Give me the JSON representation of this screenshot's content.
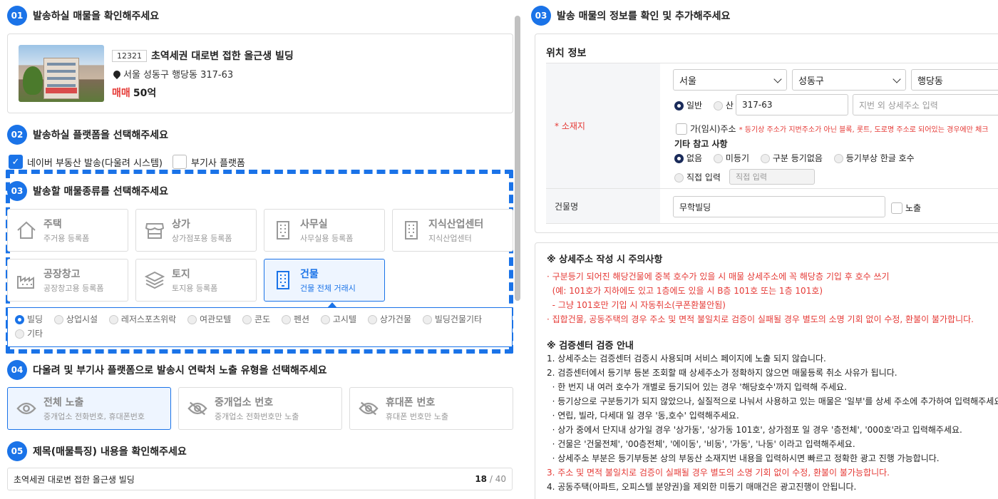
{
  "sec1": {
    "num": "01",
    "title": "발송하실 매물을 확인해주세요"
  },
  "property": {
    "id": "12321",
    "name": "초역세권 대로변 접한 올근생 빌딩",
    "address": "서울 성동구 행당동 317-63",
    "price_type": "매매",
    "price": "50억"
  },
  "sec2": {
    "num": "02",
    "title": "발송하실 플랫폼을 선택해주세요"
  },
  "platforms": [
    {
      "label": "네이버 부동산 발송(다울려 시스템)",
      "checked": true
    },
    {
      "label": "부기사 플랫폼",
      "checked": false
    }
  ],
  "sec3": {
    "num": "03",
    "title": "발송할 매물종류를 선택해주세요"
  },
  "types": [
    {
      "name": "주택",
      "sub": "주거용 등록폼",
      "icon": "house-icon",
      "selected": false
    },
    {
      "name": "상가",
      "sub": "상가점포용 등록폼",
      "icon": "store-icon",
      "selected": false
    },
    {
      "name": "사무실",
      "sub": "사무실용 등록폼",
      "icon": "office-icon",
      "selected": false
    },
    {
      "name": "지식산업센터",
      "sub": "지식산업센터",
      "icon": "office-icon",
      "selected": false
    },
    {
      "name": "공장창고",
      "sub": "공장창고용 등록폼",
      "icon": "factory-icon",
      "selected": false
    },
    {
      "name": "토지",
      "sub": "토지용 등록폼",
      "icon": "layers-icon",
      "selected": false
    },
    {
      "name": "건물",
      "sub": "건물 전체 거래시",
      "icon": "building-icon",
      "selected": true
    }
  ],
  "subtypes": [
    "빌딩",
    "상업시설",
    "레저스포츠위락",
    "여관모텔",
    "콘도",
    "펜션",
    "고시텔",
    "상가건물",
    "빌딩건물기타",
    "기타"
  ],
  "sec4": {
    "num": "04",
    "title": "다울려 및 부기사 플랫폼으로 발송시 연락처 노출 유형을 선택해주세요"
  },
  "exposure": [
    {
      "name": "전체 노출",
      "sub": "중개업소 전화번호, 휴대폰번호",
      "selected": true
    },
    {
      "name": "중개업소 번호",
      "sub": "중개업소 전화번호만 노출",
      "selected": false
    },
    {
      "name": "휴대폰 번호",
      "sub": "휴대폰 번호만 노출",
      "selected": false
    }
  ],
  "sec5": {
    "num": "05",
    "title": "제목(매물특징) 내용을 확인해주세요"
  },
  "title_input": {
    "value": "초역세권 대로변 접한 올근생 빌딩",
    "count": "18",
    "max": "/ 40"
  },
  "right_sec": {
    "num": "03",
    "title": "발송 매물의 정보를 확인 및 추가해주세요"
  },
  "location": {
    "heading": "위치 정보",
    "label": "* 소재지",
    "city": "서울",
    "district": "성동구",
    "dong": "행당동",
    "lot_types": [
      "일반",
      "산"
    ],
    "lot_number": "317-63",
    "detail_placeholder": "지번 외 상세주소 입력",
    "temp_addr_label": "가(임시)주소",
    "temp_addr_note": "* 등기상 주소가 지번주소가 아닌 블록, 롯트, 도로명 주소로 되어있는 경우에만 체크",
    "ref_heading": "기타 참고 사항",
    "ref_options": [
      "없음",
      "미등기",
      "구분 등기없음",
      "등기부상 한글 호수"
    ],
    "direct_label": "직접 입력",
    "direct_placeholder": "직접 입력",
    "building_label": "건물명",
    "building_value": "무학빌딩",
    "expose_label": "노출"
  },
  "notice": {
    "title": "※ 상세주소 작성 시 주의사항",
    "red_lines": [
      "· 구분등기 되어진 해당건물에 중복 호수가 있을 시 매물 상세주소에 꼭 해당층 기입 후 호수 쓰기",
      "  (예: 101호가 지하에도 있고 1층에도 있을 시 B층 101호 또는 1층 101호)",
      "  - 그냥 101호만 기입 시 자동취소(쿠폰환불안됨)",
      "· 집합건물, 공동주택의 경우 주소 및 면적 불일치로 검증이 실패될 경우 별도의 소명 기회 없이 수정, 환불이 불가합니다."
    ],
    "guide_title": "※ 검증센터 검증 안내",
    "guide_lines": [
      {
        "text": "1. 상세주소는 검증센터 검증시 사용되며 서비스 페이지에 노출 되지 않습니다.",
        "red": false
      },
      {
        "text": "2. 검증센터에서 등기부 등본 조회할 때 상세주소가 정확하지 않으면 매물등록 취소 사유가 됩니다.",
        "red": false
      },
      {
        "text": "  · 한 번지 내 여러 호수가 개별로 등기되어 있는 경우 '해당호수'까지 입력해 주세요.",
        "red": false
      },
      {
        "text": "  · 등기상으로 구분등기가 되지 않았으나, 실질적으로 나눠서 사용하고 있는 매물은 '일부'를 상세 주소에 추가하여 입력해주세요.",
        "red": false
      },
      {
        "text": "  · 연립, 빌라, 다세대 일 경우 '동,호수' 입력해주세요.",
        "red": false
      },
      {
        "text": "  · 상가 중에서 단지내 상가일 경우 '상가동', '상가동 101호', 상가점포 일 경우 '층전체', '000호'라고 입력해주세요.",
        "red": false
      },
      {
        "text": "  · 건물은 '건물전체', '00층전체', '에이동', '비동', '가동', '나동' 이라고 입력해주세요.",
        "red": false
      },
      {
        "text": "  · 상세주소 부분은 등기부등본 상의 부동산 소재지번 내용을 입력하시면 빠르고 정확한 광고 진행 가능합니다.",
        "red": false
      },
      {
        "text": "3. 주소 및 면적 불일치로 검증이 실패될 경우 별도의 소명 기회 없이 수정, 환불이 불가능합니다.",
        "red": true
      },
      {
        "text": "4. 공동주택(아파트, 오피스텔 분양권)을 제외한 미등기 매매건은 광고진행이 안됩니다.",
        "red": false
      }
    ]
  }
}
